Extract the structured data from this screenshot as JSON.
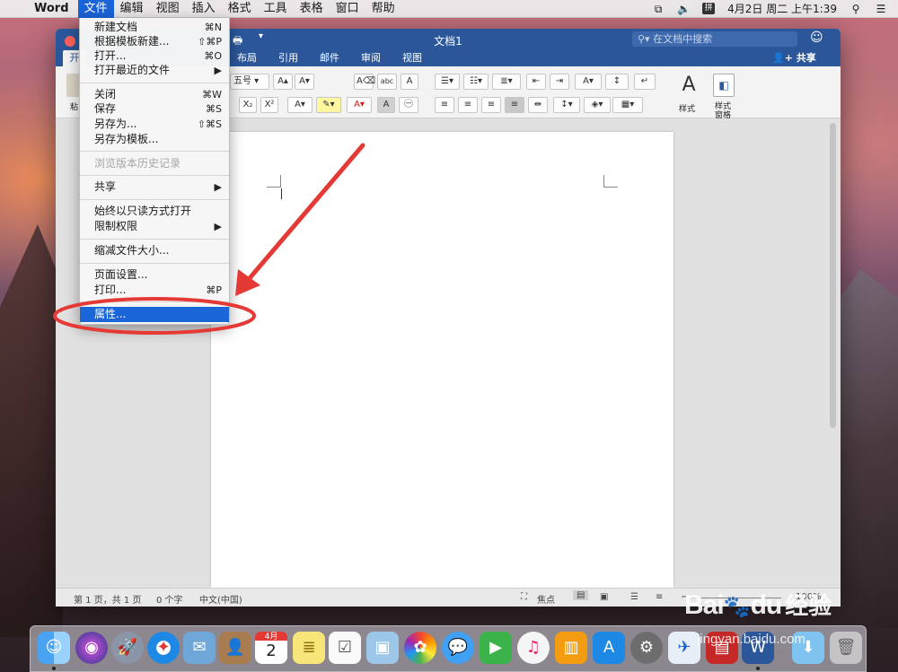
{
  "menubar": {
    "app_name": "Word",
    "items": [
      "文件",
      "编辑",
      "视图",
      "插入",
      "格式",
      "工具",
      "表格",
      "窗口",
      "帮助"
    ],
    "input_method": "拼",
    "clock": "4月2日 周二 上午1:39"
  },
  "window": {
    "title": "文档1",
    "search_placeholder": "在文档中搜索",
    "tabs": [
      "开",
      "布局",
      "引用",
      "邮件",
      "审阅",
      "视图"
    ],
    "share_label": "共享",
    "ribbon": {
      "font_size": "五号",
      "styles_label": "样式",
      "styles_pane_label_1": "样式",
      "styles_pane_label_2": "窗格",
      "paste_label": "粘"
    },
    "status": {
      "page": "第 1 页，共 1 页",
      "words": "0 个字",
      "language": "中文(中国)",
      "focus": "焦点",
      "zoom": "100%"
    }
  },
  "file_menu": {
    "items": [
      {
        "label": "新建文档",
        "shortcut": "⌘N"
      },
      {
        "label": "根据模板新建...",
        "shortcut": "⇧⌘P"
      },
      {
        "label": "打开...",
        "shortcut": "⌘O"
      },
      {
        "label": "打开最近的文件",
        "shortcut": "▶"
      },
      {
        "label": "关闭",
        "shortcut": "⌘W"
      },
      {
        "label": "保存",
        "shortcut": "⌘S"
      },
      {
        "label": "另存为...",
        "shortcut": "⇧⌘S"
      },
      {
        "label": "另存为模板...",
        "shortcut": ""
      },
      {
        "label": "浏览版本历史记录",
        "shortcut": ""
      },
      {
        "label": "共享",
        "shortcut": "▶"
      },
      {
        "label": "始终以只读方式打开",
        "shortcut": ""
      },
      {
        "label": "限制权限",
        "shortcut": "▶"
      },
      {
        "label": "缩减文件大小...",
        "shortcut": ""
      },
      {
        "label": "页面设置...",
        "shortcut": ""
      },
      {
        "label": "打印...",
        "shortcut": "⌘P"
      },
      {
        "label": "属性...",
        "shortcut": ""
      }
    ]
  },
  "dock": {
    "calendar_month": "4月",
    "calendar_day": "2",
    "icons": [
      "finder-icon",
      "siri-icon",
      "launchpad-icon",
      "safari-icon",
      "mail-icon",
      "contacts-icon",
      "calendar-icon",
      "notes-icon",
      "reminders-icon",
      "preview-icon",
      "photos-icon",
      "messages-icon",
      "facetime-icon",
      "music-icon",
      "books-icon",
      "app-store-icon",
      "system-preferences-icon",
      "feishu-icon",
      "pdf-icon",
      "word-icon",
      "downloads-icon",
      "trash-icon"
    ]
  },
  "watermark": {
    "brand": "Bai",
    "brand_suffix": "du",
    "cn": "经验",
    "url": "jingyan.baidu.com"
  },
  "colors": {
    "word_blue": "#2b579a",
    "menu_highlight": "#1a66d9",
    "annotation_red": "#e53935"
  }
}
